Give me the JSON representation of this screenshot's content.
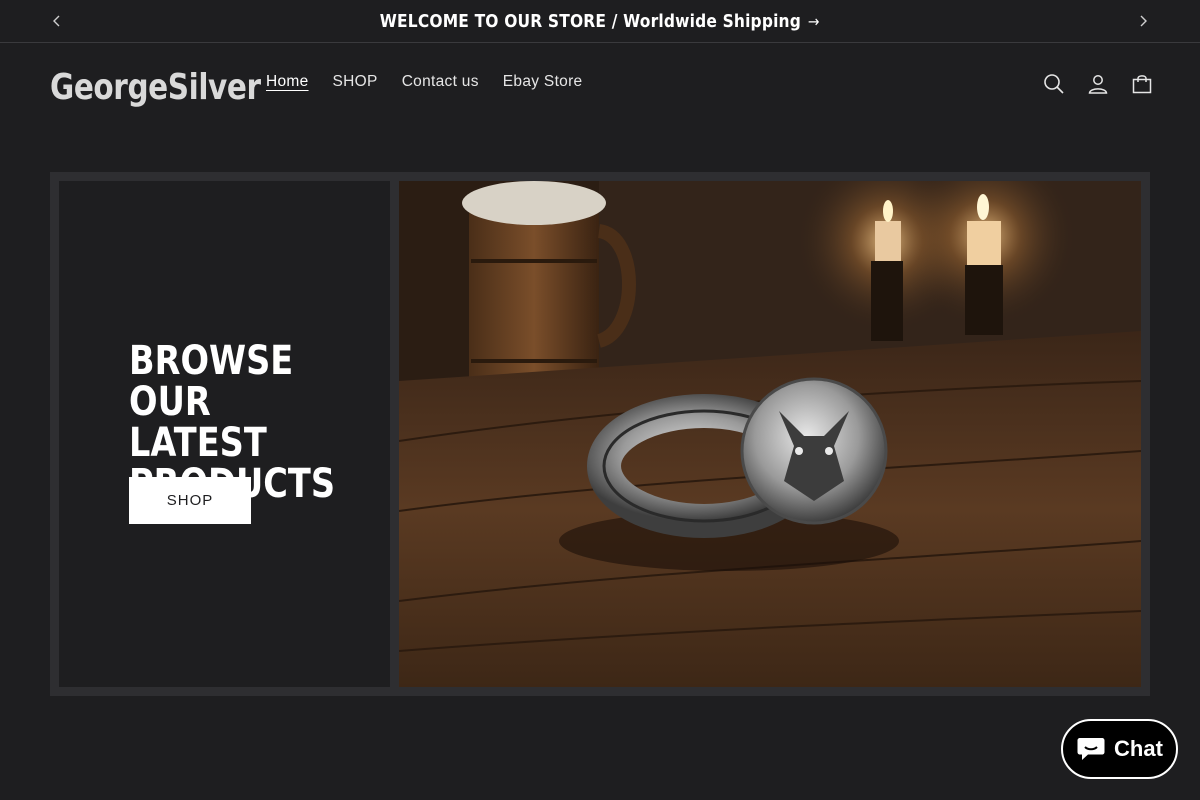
{
  "announcement": {
    "text": "WELCOME TO OUR STORE / Worldwide Shipping",
    "prev_icon": "chevron-left-icon",
    "next_icon": "chevron-right-icon"
  },
  "header": {
    "logo": "GeorgeSilver",
    "nav": [
      {
        "label": "Home",
        "active": true
      },
      {
        "label": "SHOP",
        "active": false
      },
      {
        "label": "Contact us",
        "active": false
      },
      {
        "label": "Ebay Store",
        "active": false
      }
    ],
    "icons": [
      "search-icon",
      "account-icon",
      "cart-icon"
    ]
  },
  "banner": {
    "heading": "BROWSE OUR LATEST PRODUCTS",
    "button_label": "SHOP",
    "image": "silver wolf ring on wooden table with candles and tankard"
  },
  "chat": {
    "label": "Chat",
    "icon": "chat-bubble-icon"
  },
  "colors": {
    "background": "#1e1e20",
    "banner_frame": "#2e2e31",
    "button_bg": "#ffffff",
    "chat_bg": "#000000"
  }
}
